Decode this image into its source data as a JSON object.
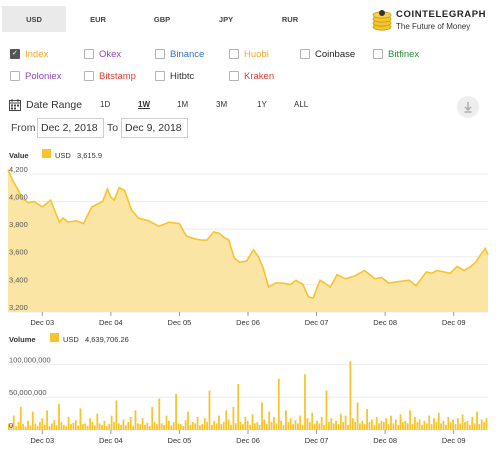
{
  "currency_tabs": [
    "USD",
    "EUR",
    "GBP",
    "JPY",
    "RUR"
  ],
  "active_currency": "USD",
  "logo": {
    "title": "COINTELEGRAPH",
    "subtitle": "The Future of Money"
  },
  "exchanges": [
    {
      "label": "Index",
      "checked": true,
      "color": "#f5a623"
    },
    {
      "label": "Okex",
      "checked": false,
      "color": "#8e44ad"
    },
    {
      "label": "Binance",
      "checked": false,
      "color": "#2f72c6"
    },
    {
      "label": "Huobi",
      "checked": false,
      "color": "#f5a623"
    },
    {
      "label": "Coinbase",
      "checked": false,
      "color": "#222222"
    },
    {
      "label": "Bitfinex",
      "checked": false,
      "color": "#2e8b3a"
    },
    {
      "label": "Poloniex",
      "checked": false,
      "color": "#8e44ad"
    },
    {
      "label": "Bitstamp",
      "checked": false,
      "color": "#e03c31"
    },
    {
      "label": "Hitbtc",
      "checked": false,
      "color": "#333333"
    },
    {
      "label": "Kraken",
      "checked": false,
      "color": "#e03c31"
    }
  ],
  "date_range": {
    "label": "Date Range",
    "ranges": [
      "1D",
      "1W",
      "1M",
      "3M",
      "1Y",
      "ALL"
    ],
    "active": "1W",
    "from_label": "From",
    "from_value": "Dec 2, 2018",
    "to_label": "To",
    "to_value": "Dec 9, 2018"
  },
  "accent_color": "#f7c42d",
  "chart_data": [
    {
      "type": "area",
      "title": "Value",
      "series_name": "USD",
      "current_value": "3,615.9",
      "ylim": [
        3200,
        4300
      ],
      "yticks": [
        "4,200",
        "4,000",
        "3,800",
        "3,600",
        "3,400",
        "3,200"
      ],
      "ytick_values": [
        4200,
        4000,
        3800,
        3600,
        3400,
        3200
      ],
      "xlim": [
        0,
        7
      ],
      "x_tick_labels": [
        "Dec 03",
        "Dec 04",
        "Dec 05",
        "Dec 06",
        "Dec 07",
        "Dec 08",
        "Dec 09"
      ],
      "x_tick_positions": [
        0.5,
        1.5,
        2.5,
        3.5,
        4.5,
        5.5,
        6.5
      ],
      "x": [
        0.0,
        0.07,
        0.14,
        0.21,
        0.3,
        0.38,
        0.5,
        0.62,
        0.75,
        0.8,
        0.88,
        1.0,
        1.1,
        1.22,
        1.38,
        1.45,
        1.5,
        1.55,
        1.62,
        1.7,
        1.8,
        1.9,
        2.05,
        2.2,
        2.35,
        2.5,
        2.6,
        2.72,
        2.82,
        2.9,
        3.0,
        3.08,
        3.15,
        3.22,
        3.3,
        3.38,
        3.48,
        3.58,
        3.65,
        3.72,
        3.8,
        3.9,
        4.0,
        4.12,
        4.2,
        4.3,
        4.38,
        4.45,
        4.55,
        4.62,
        4.7,
        4.8,
        4.92,
        5.05,
        5.2,
        5.35,
        5.45,
        5.55,
        5.7,
        5.85,
        5.95,
        6.1,
        6.18,
        6.25,
        6.35,
        6.45,
        6.55,
        6.65,
        6.75,
        6.82,
        6.9,
        6.96,
        7.0
      ],
      "values": [
        4230,
        4150,
        4090,
        4020,
        3990,
        4000,
        3960,
        4010,
        3850,
        3880,
        3850,
        3860,
        3840,
        3960,
        4000,
        4090,
        4030,
        4010,
        4100,
        4080,
        3940,
        3880,
        3860,
        3820,
        3850,
        3840,
        3750,
        3730,
        3720,
        3720,
        3780,
        3770,
        3740,
        3720,
        3590,
        3560,
        3570,
        3650,
        3600,
        3520,
        3380,
        3410,
        3410,
        3400,
        3430,
        3400,
        3310,
        3300,
        3430,
        3410,
        3380,
        3470,
        3440,
        3460,
        3500,
        3440,
        3450,
        3410,
        3420,
        3430,
        3390,
        3490,
        3480,
        3500,
        3490,
        3480,
        3530,
        3500,
        3530,
        3560,
        3620,
        3660,
        3615
      ]
    },
    {
      "type": "bar",
      "title": "Volume",
      "series_name": "USD",
      "current_value": "4,639,706.26",
      "ylim": [
        0,
        125000000
      ],
      "yticks": [
        "100,000,000",
        "50,000,000",
        "0"
      ],
      "ytick_values": [
        100000000,
        50000000,
        0
      ],
      "x_tick_labels": [
        "Dec 03",
        "Dec 04",
        "Dec 05",
        "Dec 06",
        "Dec 07",
        "Dec 08",
        "Dec 09"
      ],
      "values": [
        10,
        8,
        22,
        6,
        12,
        35,
        9,
        5,
        14,
        7,
        28,
        10,
        6,
        12,
        18,
        8,
        30,
        6,
        10,
        15,
        7,
        40,
        12,
        8,
        6,
        20,
        9,
        11,
        15,
        7,
        33,
        9,
        10,
        6,
        18,
        12,
        7,
        25,
        10,
        8,
        14,
        6,
        9,
        22,
        12,
        45,
        10,
        8,
        16,
        7,
        12,
        20,
        6,
        30,
        10,
        9,
        18,
        8,
        11,
        6,
        35,
        12,
        9,
        48,
        10,
        8,
        22,
        14,
        7,
        12,
        55,
        10,
        9,
        6,
        15,
        28,
        8,
        12,
        10,
        20,
        7,
        9,
        18,
        12,
        60,
        8,
        14,
        10,
        22,
        9,
        12,
        30,
        16,
        8,
        35,
        10,
        70,
        12,
        9,
        20,
        14,
        8,
        24,
        10,
        12,
        8,
        42,
        16,
        9,
        28,
        12,
        20,
        10,
        78,
        14,
        8,
        30,
        12,
        18,
        9,
        15,
        10,
        22,
        8,
        85,
        18,
        12,
        26,
        9,
        14,
        10,
        20,
        8,
        60,
        12,
        18,
        10,
        14,
        9,
        25,
        12,
        22,
        8,
        105,
        18,
        12,
        42,
        10,
        14,
        9,
        32,
        12,
        16,
        8,
        20,
        10,
        14,
        12,
        18,
        9,
        22,
        10,
        16,
        8,
        24,
        12,
        14,
        10,
        30,
        9,
        20,
        12,
        16,
        8,
        14,
        10,
        22,
        9,
        18,
        12,
        26,
        10,
        14,
        8,
        20,
        12,
        16,
        9,
        18,
        10,
        24,
        12,
        14,
        8,
        20,
        10,
        28,
        9,
        16,
        12,
        18
      ]
    }
  ]
}
